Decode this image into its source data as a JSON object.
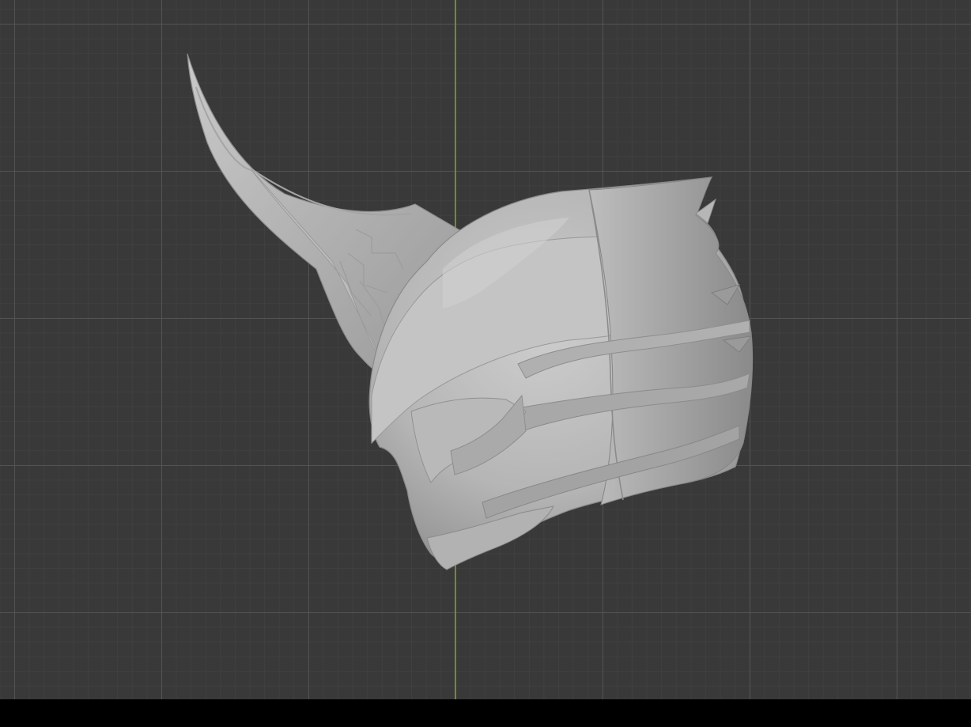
{
  "viewport": {
    "background_color": "#393939",
    "grid_major_color": "#545454",
    "grid_minor_color": "#404040",
    "y_axis_color": "#6f8d2e",
    "model_color": "#b4b4b4",
    "bottom_bar_color": "#000000"
  },
  "model": {
    "object_name": "helmet-with-horn-icon",
    "material": "clay-gray"
  }
}
